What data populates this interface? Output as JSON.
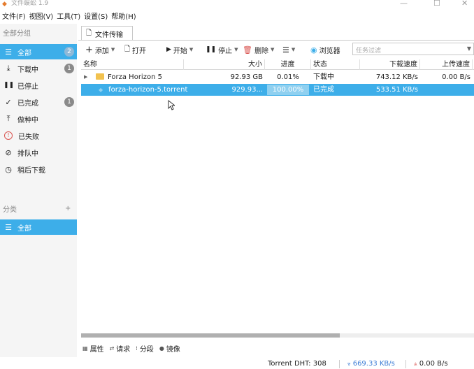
{
  "window": {
    "title": "文件蜈蚣 1.9",
    "app_icon": "logo-icon",
    "controls": [
      "—",
      "☐",
      "✕"
    ]
  },
  "menu": [
    "文件(F)",
    "视图(V)",
    "工具(T)",
    "设置(S)",
    "帮助(H)"
  ],
  "sidebar": {
    "groups_heading": "全部分组",
    "items": [
      {
        "label": "全部",
        "icon": "list-icon",
        "glyph": "☰",
        "badge": "2",
        "active": true
      },
      {
        "label": "下载中",
        "icon": "download-icon",
        "glyph": "⤓",
        "badge": "1"
      },
      {
        "label": "已停止",
        "icon": "pause-icon",
        "glyph": "❚❚",
        "badge": ""
      },
      {
        "label": "已完成",
        "icon": "check-icon",
        "glyph": "✓",
        "badge": "1"
      },
      {
        "label": "做种中",
        "icon": "upload-icon",
        "glyph": "⤒",
        "badge": ""
      },
      {
        "label": "已失败",
        "icon": "alert-icon",
        "glyph": "!",
        "badge": ""
      },
      {
        "label": "排队中",
        "icon": "queue-icon",
        "glyph": "⊘",
        "badge": ""
      },
      {
        "label": "稍后下载",
        "icon": "clock-icon",
        "glyph": "◷",
        "badge": ""
      }
    ],
    "category_heading": "分类",
    "category_add": "+",
    "category_items": [
      {
        "label": "全部",
        "icon": "list-icon",
        "glyph": "☰",
        "active": true
      }
    ]
  },
  "tab": {
    "label": "文件传输",
    "icon": "file-icon",
    "glyph": "🗋"
  },
  "toolbar": {
    "add": "添加",
    "open": "打开",
    "start": "开始",
    "stop": "停止",
    "delete": "删除",
    "more": "☰",
    "browser": "浏览器",
    "filter_placeholder": "任务过滤"
  },
  "table": {
    "columns": [
      "名称",
      "大小",
      "进度",
      "状态",
      "下载速度",
      "上传速度"
    ],
    "rows": [
      {
        "name": "Forza  Horizon 5",
        "size": "92.93 GB",
        "progress": "0.01%",
        "status": "下载中",
        "down": "743.12 KB/s",
        "up": "0.00 B/s",
        "type": "folder"
      },
      {
        "name": "forza-horizon-5.torrent",
        "size": "929.93...",
        "progress": "100.00%",
        "status": "已完成",
        "down": "533.51 KB/s",
        "up": "",
        "type": "torrent",
        "selected": true
      }
    ]
  },
  "bottom_tabs": [
    {
      "label": "属性",
      "icon": "properties-icon",
      "glyph": "▦"
    },
    {
      "label": "请求",
      "icon": "request-icon",
      "glyph": "⇄"
    },
    {
      "label": "分段",
      "icon": "segments-icon",
      "glyph": "⁞"
    },
    {
      "label": "镜像",
      "icon": "mirror-icon",
      "glyph": "●"
    }
  ],
  "status": {
    "dht": "Torrent DHT:  308",
    "down": "669.33 KB/s",
    "up": "0.00 B/s",
    "down_color": "#3a7bd5",
    "up_color": "#d9534f"
  },
  "colors": {
    "accent": "#3daee9",
    "progress": "#8fd0f0"
  }
}
